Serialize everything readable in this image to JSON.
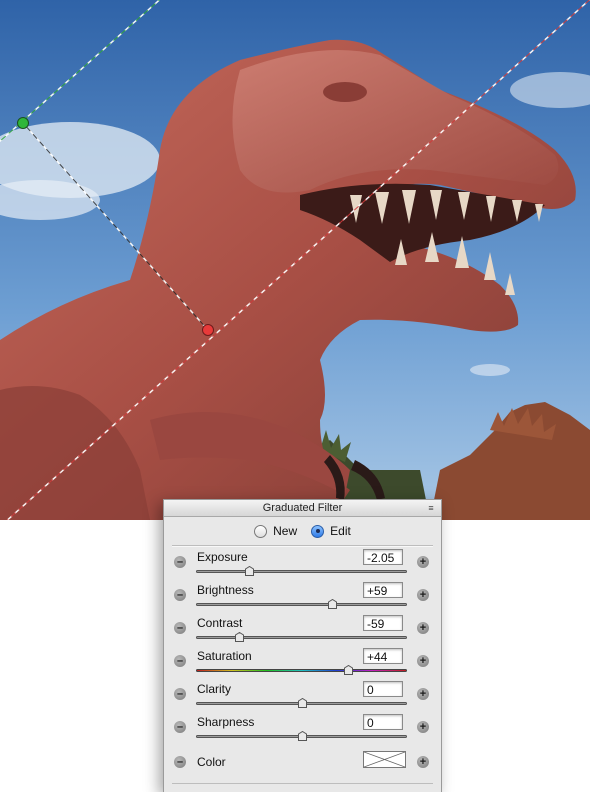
{
  "panel": {
    "title": "Graduated Filter",
    "mode_options": [
      {
        "label": "New",
        "selected": false
      },
      {
        "label": "Edit",
        "selected": true
      }
    ],
    "sliders": [
      {
        "label": "Exposure",
        "value": "-2.05",
        "level": 0.25
      },
      {
        "label": "Brightness",
        "value": "+59",
        "level": 0.645
      },
      {
        "label": "Contrast",
        "value": "-59",
        "level": 0.205
      },
      {
        "label": "Saturation",
        "value": "+44",
        "level": 0.72
      },
      {
        "label": "Clarity",
        "value": "0",
        "level": 0.5
      },
      {
        "label": "Sharpness",
        "value": "0",
        "level": 0.5
      }
    ],
    "color_label": "Color",
    "minus_glyph": "–",
    "plus_glyph": "+",
    "menu_glyph": "≡"
  },
  "colors": {
    "start_handle": "#2fb63a",
    "end_handle": "#e83a3a",
    "sky": "#3f78bf",
    "statue": "#b4574a"
  }
}
